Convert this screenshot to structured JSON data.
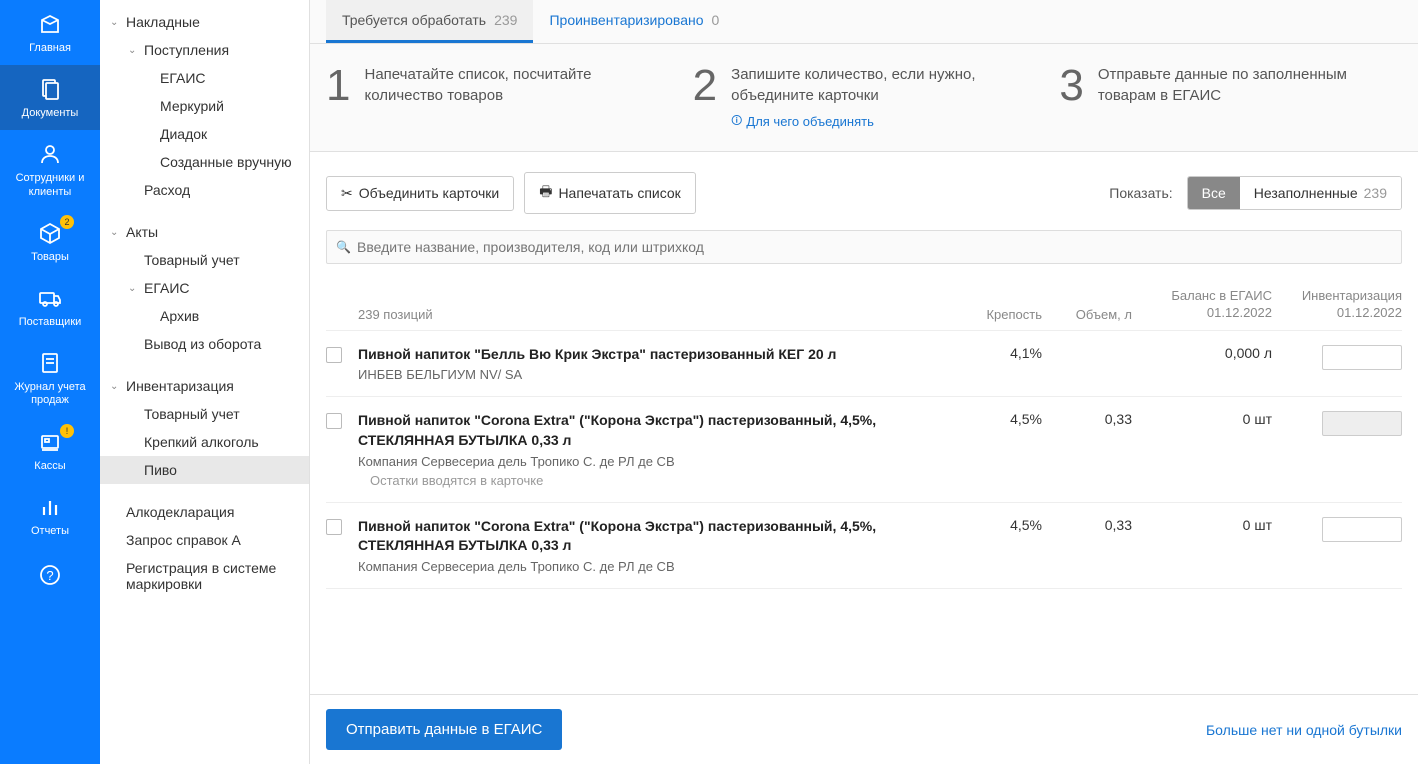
{
  "rail": [
    {
      "id": "home",
      "label": "Главная",
      "badge": null
    },
    {
      "id": "docs",
      "label": "Документы",
      "badge": null,
      "active": true
    },
    {
      "id": "people",
      "label": "Сотрудники и клиенты",
      "badge": null
    },
    {
      "id": "goods",
      "label": "Товары",
      "badge": "2"
    },
    {
      "id": "suppliers",
      "label": "Поставщики",
      "badge": null
    },
    {
      "id": "salesjournal",
      "label": "Журнал учета продаж",
      "badge": null
    },
    {
      "id": "pos",
      "label": "Кассы",
      "badge": "!"
    },
    {
      "id": "reports",
      "label": "Отчеты",
      "badge": null
    },
    {
      "id": "help",
      "label": "",
      "badge": null
    }
  ],
  "tree": [
    {
      "label": "Накладные",
      "level": 0,
      "expandable": true
    },
    {
      "label": "Поступления",
      "level": 1,
      "expandable": true
    },
    {
      "label": "ЕГАИС",
      "level": 2
    },
    {
      "label": "Меркурий",
      "level": 2
    },
    {
      "label": "Диадок",
      "level": 2
    },
    {
      "label": "Созданные вручную",
      "level": 2
    },
    {
      "label": "Расход",
      "level": 1
    },
    {
      "label": "Акты",
      "level": 0,
      "expandable": true
    },
    {
      "label": "Товарный учет",
      "level": 1
    },
    {
      "label": "ЕГАИС",
      "level": 1,
      "expandable": true
    },
    {
      "label": "Архив",
      "level": 2
    },
    {
      "label": "Вывод из оборота",
      "level": 1
    },
    {
      "label": "Инвентаризация",
      "level": 0,
      "expandable": true
    },
    {
      "label": "Товарный учет",
      "level": 1
    },
    {
      "label": "Крепкий алкоголь",
      "level": 1
    },
    {
      "label": "Пиво",
      "level": 1,
      "selected": true
    },
    {
      "label": "Алкодекларация",
      "level": 0,
      "simple": true
    },
    {
      "label": "Запрос справок А",
      "level": 0,
      "simple": true
    },
    {
      "label": "Регистрация в системе маркировки",
      "level": 0,
      "simple": true
    }
  ],
  "tabs": [
    {
      "label": "Требуется обработать",
      "count": "239",
      "active": true
    },
    {
      "label": "Проинвентаризировано",
      "count": "0"
    }
  ],
  "steps": [
    {
      "num": "1",
      "text": "Напечатайте список, посчитайте количество товаров"
    },
    {
      "num": "2",
      "text": "Запишите количество, если нужно, объедините карточки",
      "link": "Для чего объединять"
    },
    {
      "num": "3",
      "text": "Отправьте данные по заполненным товарам в ЕГАИС"
    }
  ],
  "toolbar": {
    "merge": "Объединить карточки",
    "print": "Напечатать список",
    "show": "Показать:",
    "all": "Все",
    "unfilled": "Незаполненные",
    "unfilled_count": "239"
  },
  "search": {
    "placeholder": "Введите название, производителя, код или штрихкод"
  },
  "thead": {
    "count": "239 позиций",
    "strength": "Крепость",
    "volume": "Объем, л",
    "balance_l1": "Баланс в ЕГАИС",
    "balance_l2": "01.12.2022",
    "inv_l1": "Инвентаризация",
    "inv_l2": "01.12.2022"
  },
  "rows": [
    {
      "name": "Пивной напиток \"Белль Вю Крик Экстра\" пастеризованный КЕГ 20 л",
      "sub": "ИНБЕВ БЕЛЬГИУМ NV/ SA",
      "strength": "4,1%",
      "volume": "",
      "balance": "0,000 л",
      "note": null,
      "input_disabled": false
    },
    {
      "name": "Пивной напиток \"Corona Extra\" (\"Корона Экстра\") пастеризованный, 4,5%, СТЕКЛЯННАЯ БУТЫЛКА 0,33 л",
      "sub": "Компания Сервесериа дель Тропико С. де РЛ де СВ",
      "strength": "4,5%",
      "volume": "0,33",
      "balance": "0 шт",
      "note": "Остатки вводятся в карточке",
      "input_disabled": true
    },
    {
      "name": "Пивной напиток \"Corona Extra\" (\"Корона Экстра\") пастеризованный, 4,5%, СТЕКЛЯННАЯ БУТЫЛКА 0,33 л",
      "sub": "Компания Сервесериа дель Тропико С. де РЛ де СВ",
      "strength": "4,5%",
      "volume": "0,33",
      "balance": "0 шт",
      "note": null,
      "input_disabled": false
    }
  ],
  "footer": {
    "submit": "Отправить данные в ЕГАИС",
    "nomore": "Больше нет ни одной бутылки"
  }
}
